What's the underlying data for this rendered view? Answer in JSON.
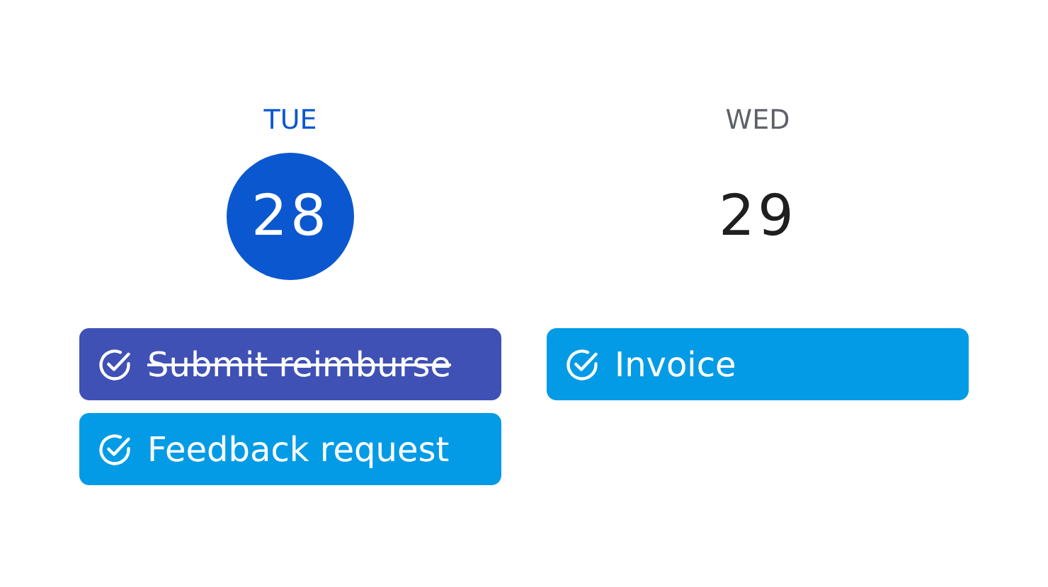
{
  "days": [
    {
      "weekday": "TUE",
      "date": "28",
      "selected": true,
      "tasks": [
        {
          "title": "Submit reimburse",
          "done": true
        },
        {
          "title": "Feedback request",
          "done": false
        }
      ]
    },
    {
      "weekday": "WED",
      "date": "29",
      "selected": false,
      "tasks": [
        {
          "title": "Invoice",
          "done": false
        }
      ]
    }
  ]
}
